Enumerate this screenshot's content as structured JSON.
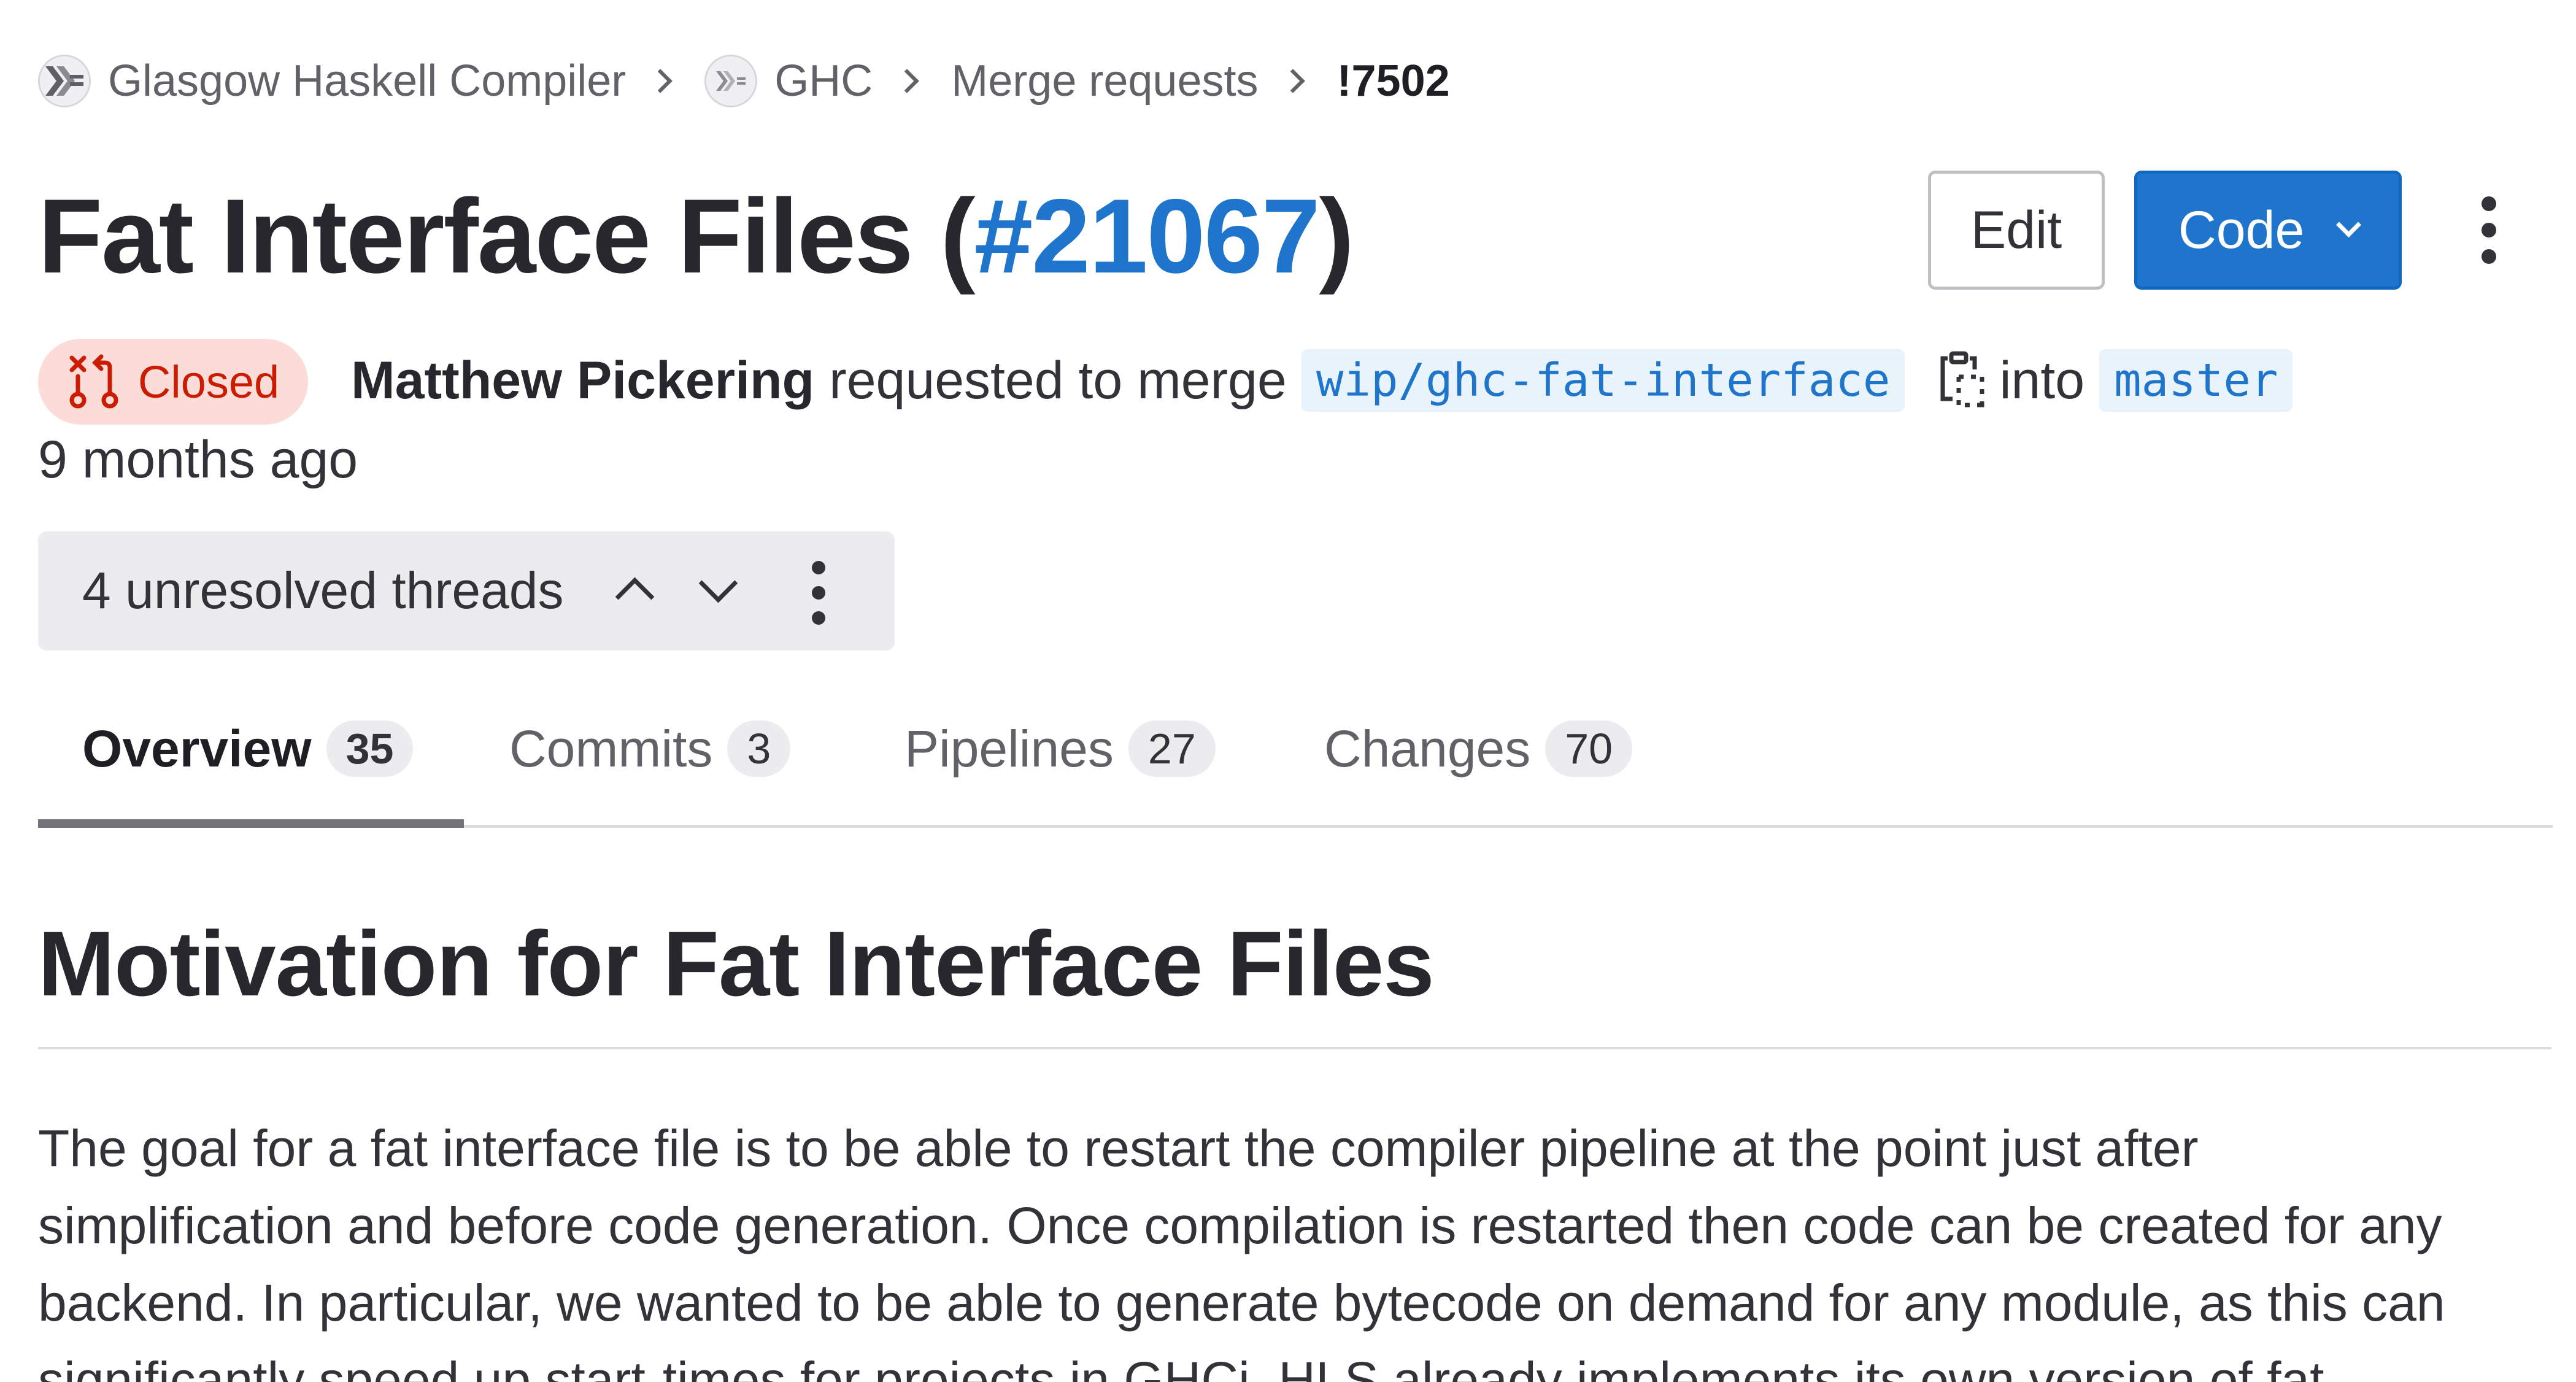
{
  "breadcrumb": {
    "items": [
      {
        "label": "Glasgow Haskell Compiler",
        "icon": "group-avatar-icon"
      },
      {
        "label": "GHC",
        "icon": "project-avatar-icon"
      },
      {
        "label": "Merge requests"
      },
      {
        "label": "!7502"
      }
    ]
  },
  "header": {
    "title": "Fat Interface Files (",
    "issue_link": "#21067",
    "title_close": ")",
    "edit_label": "Edit",
    "code_label": "Code"
  },
  "status": {
    "badge_label": "Closed",
    "author": "Matthew Pickering",
    "action_text": "requested to merge",
    "source_branch": "wip/ghc-fat-interface",
    "into_text": "into",
    "target_branch": "master",
    "time_ago": "9 months ago"
  },
  "threads": {
    "label": "4 unresolved threads"
  },
  "tabs": [
    {
      "label": "Overview",
      "count": "35",
      "active": true
    },
    {
      "label": "Commits",
      "count": "3",
      "active": false
    },
    {
      "label": "Pipelines",
      "count": "27",
      "active": false
    },
    {
      "label": "Changes",
      "count": "70",
      "active": false
    }
  ],
  "content": {
    "heading": "Motivation for Fat Interface Files",
    "paragraph_lines": [
      "The goal for a fat interface file is to be able to restart the compiler pipeline at the point just after",
      "simplification and before code generation. Once compilation is restarted then code can be created for any",
      "backend. In particular, we wanted to be able to generate bytecode on demand for any module, as this can",
      "significantly speed up start-times for projects in GHCi. HLS already implements its own version of fat"
    ]
  },
  "colors": {
    "link_blue": "#1f75cb",
    "closed_red": "#c91c00",
    "closed_bg": "#fcdcd9"
  }
}
